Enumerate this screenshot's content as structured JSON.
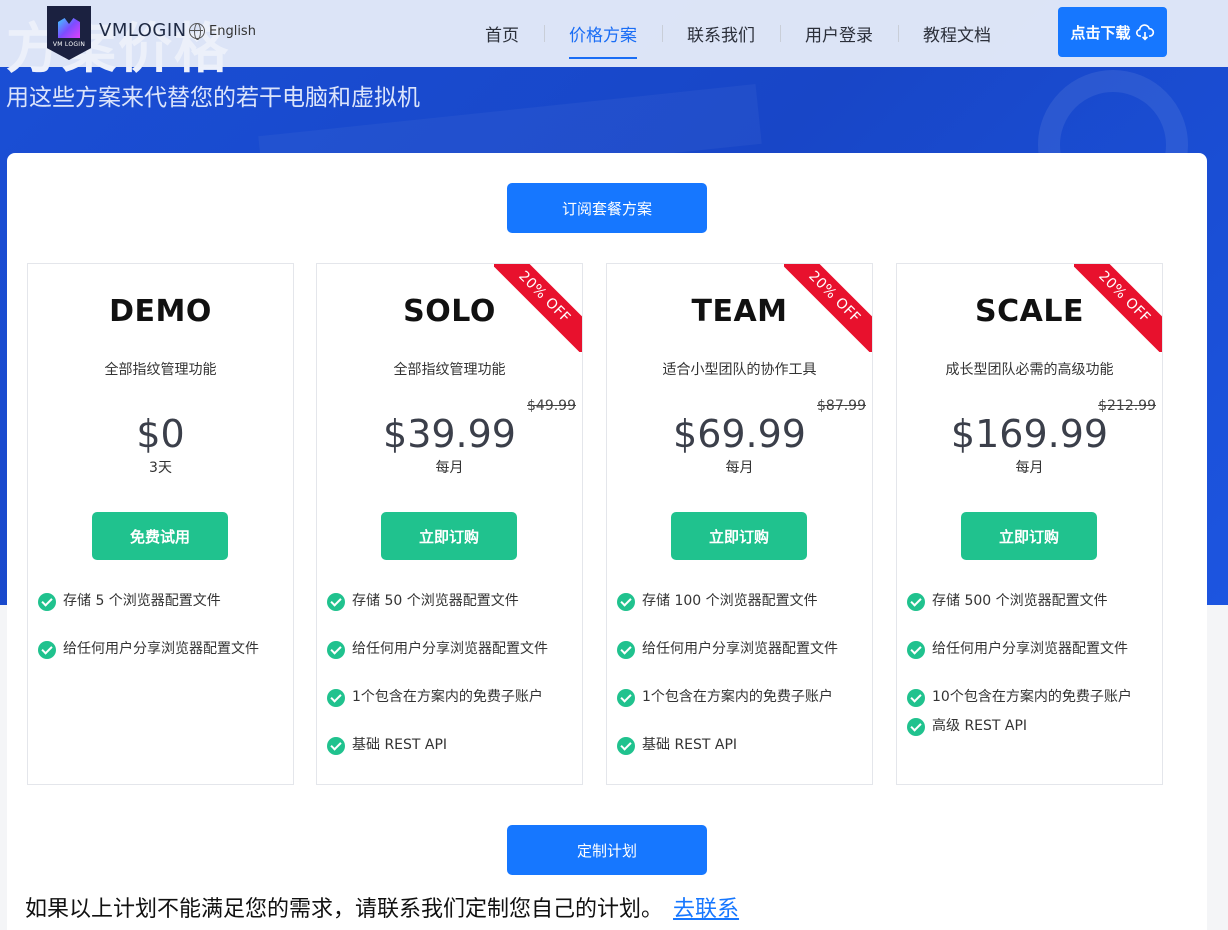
{
  "hero": {
    "title": "方案价格",
    "subtitle": "用这些方案来代替您的若干电脑和虚拟机"
  },
  "nav": {
    "logo_small": "VM LOGIN",
    "brand": "VMLOGIN",
    "language": "English",
    "links": [
      {
        "label": "首页",
        "active": false
      },
      {
        "label": "价格方案",
        "active": true
      },
      {
        "label": "联系我们",
        "active": false
      },
      {
        "label": "用户登录",
        "active": false
      },
      {
        "label": "教程文档",
        "active": false
      }
    ],
    "download_label": "点击下载"
  },
  "subscribe_label": "订阅套餐方案",
  "plans": [
    {
      "name": "DEMO",
      "desc": "全部指纹管理功能",
      "old_price": "",
      "ribbon": "",
      "price": "$0",
      "period": "3天",
      "button": "免费试用",
      "features": [
        "存储 5 个浏览器配置文件",
        "给任何用户分享浏览器配置文件"
      ]
    },
    {
      "name": "SOLO",
      "desc": "全部指纹管理功能",
      "old_price": "$49.99",
      "ribbon": "20% OFF",
      "price": "$39.99",
      "period": "每月",
      "button": "立即订购",
      "features": [
        "存储 50 个浏览器配置文件",
        "给任何用户分享浏览器配置文件",
        "1个包含在方案内的免费子账户",
        "基础 REST API"
      ]
    },
    {
      "name": "TEAM",
      "desc": "适合小型团队的协作工具",
      "old_price": "$87.99",
      "ribbon": "20% OFF",
      "price": "$69.99",
      "period": "每月",
      "button": "立即订购",
      "features": [
        "存储 100 个浏览器配置文件",
        "给任何用户分享浏览器配置文件",
        "1个包含在方案内的免费子账户",
        "基础 REST API"
      ]
    },
    {
      "name": "SCALE",
      "desc": "成长型团队必需的高级功能",
      "old_price": "$212.99",
      "ribbon": "20% OFF",
      "price": "$169.99",
      "period": "每月",
      "button": "立即订购",
      "features": [
        "存储 500 个浏览器配置文件",
        "给任何用户分享浏览器配置文件",
        "10个包含在方案内的免费子账户",
        "高级 REST API"
      ]
    }
  ],
  "custom": {
    "button_label": "定制计划",
    "text": "如果以上计划不能满足您的需求，请联系我们定制您自己的计划。",
    "link_label": "去联系"
  },
  "colors": {
    "primary_blue": "#1677ff",
    "green": "#20c28e",
    "ribbon_red": "#e8112d"
  }
}
